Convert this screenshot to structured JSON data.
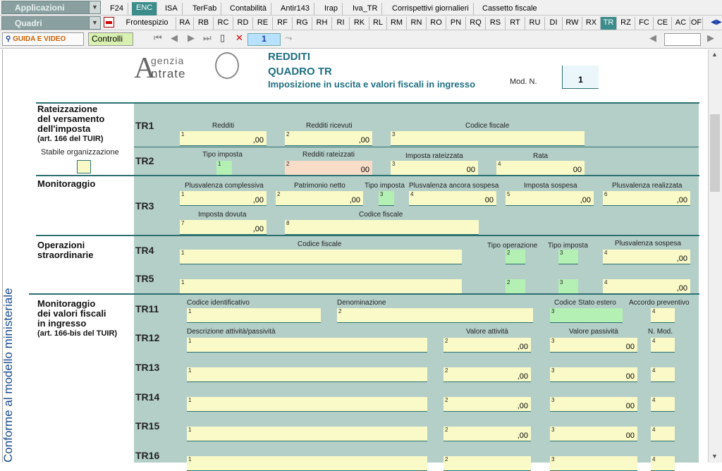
{
  "top_tabs": {
    "applicazioni": "Applicazioni",
    "items": [
      "F24",
      "ENC",
      "ISA",
      "TerFab",
      "Contabilità",
      "Antir143",
      "Irap",
      "Iva_TR",
      "Corrispettivi giornalieri",
      "Cassetto fiscale"
    ],
    "active": "ENC"
  },
  "quadri_bar": {
    "quadri": "Quadri",
    "items": [
      "Frontespizio",
      "RA",
      "RB",
      "RC",
      "RD",
      "RE",
      "RF",
      "RG",
      "RH",
      "RI",
      "RK",
      "RL",
      "RM",
      "RN",
      "RO",
      "PN",
      "RQ",
      "RS",
      "RT",
      "RU",
      "DI",
      "RW",
      "RX",
      "TR",
      "RZ",
      "FC",
      "CE",
      "AC",
      "OF"
    ],
    "active": "TR"
  },
  "toolbar": {
    "guide": "GUIDA E VIDEO",
    "controlli": "Controlli",
    "page": "1"
  },
  "header": {
    "logo_line1": "genzia",
    "logo_line2": "ntrate",
    "title1": "REDDITI",
    "title2": "QUADRO TR",
    "subtitle": "Imposizione in uscita e valori fiscali in ingresso",
    "mod_label": "Mod. N.",
    "mod_value": "1"
  },
  "side_text": "Conforme al modello ministeriale",
  "sections": {
    "s1": [
      "Rateizzazione",
      "del versamento",
      "dell'imposta"
    ],
    "s1_sub": "(art. 166 del TUIR)",
    "s1_stabile": "Stabile organizzazione",
    "s2": "Monitoraggio",
    "s3": [
      "Operazioni",
      "straordinarie"
    ],
    "s4": [
      "Monitoraggio",
      "dei valori fiscali",
      "in ingresso"
    ],
    "s4_sub": "(art. 166-bis del TUIR)"
  },
  "rows": {
    "tr1": "TR1",
    "tr2": "TR2",
    "tr3": "TR3",
    "tr4": "TR4",
    "tr5": "TR5",
    "tr11": "TR11",
    "tr12": "TR12",
    "tr13": "TR13",
    "tr14": "TR14",
    "tr15": "TR15",
    "tr16": "TR16"
  },
  "labels": {
    "redditi": "Redditi",
    "redditi_ricevuti": "Redditi ricevuti",
    "codice_fiscale": "Codice fiscale",
    "tipo_imposta": "Tipo imposta",
    "redditi_rateizzati": "Redditi rateizzati",
    "imposta_rateizzata": "Imposta rateizzata",
    "rata": "Rata",
    "plusvalenza_complessiva": "Plusvalenza complessiva",
    "patrimonio_netto": "Patrimonio netto",
    "plusvalenza_sospesa_ancora": "Plusvalenza ancora sospesa",
    "imposta_sospesa": "Imposta sospesa",
    "plusvalenza_realizzata": "Plusvalenza realizzata",
    "imposta_dovuta": "Imposta dovuta",
    "tipo_operazione": "Tipo operazione",
    "plusvalenza_sospesa": "Plusvalenza sospesa",
    "codice_identificativo": "Codice identificativo",
    "denominazione": "Denominazione",
    "codice_stato_estero": "Codice Stato estero",
    "accordo_preventivo": "Accordo preventivo",
    "descrizione": "Descrizione attività/passività",
    "valore_attivita": "Valore attività",
    "valore_passivita": "Valore passività",
    "n_mod": "N. Mod."
  },
  "suffix_a": ",00",
  "suffix_b": "00",
  "num": {
    "n1": "1",
    "n2": "2",
    "n3": "3",
    "n4": "4",
    "n5": "5",
    "n6": "6",
    "n7": "7",
    "n8": "8"
  }
}
